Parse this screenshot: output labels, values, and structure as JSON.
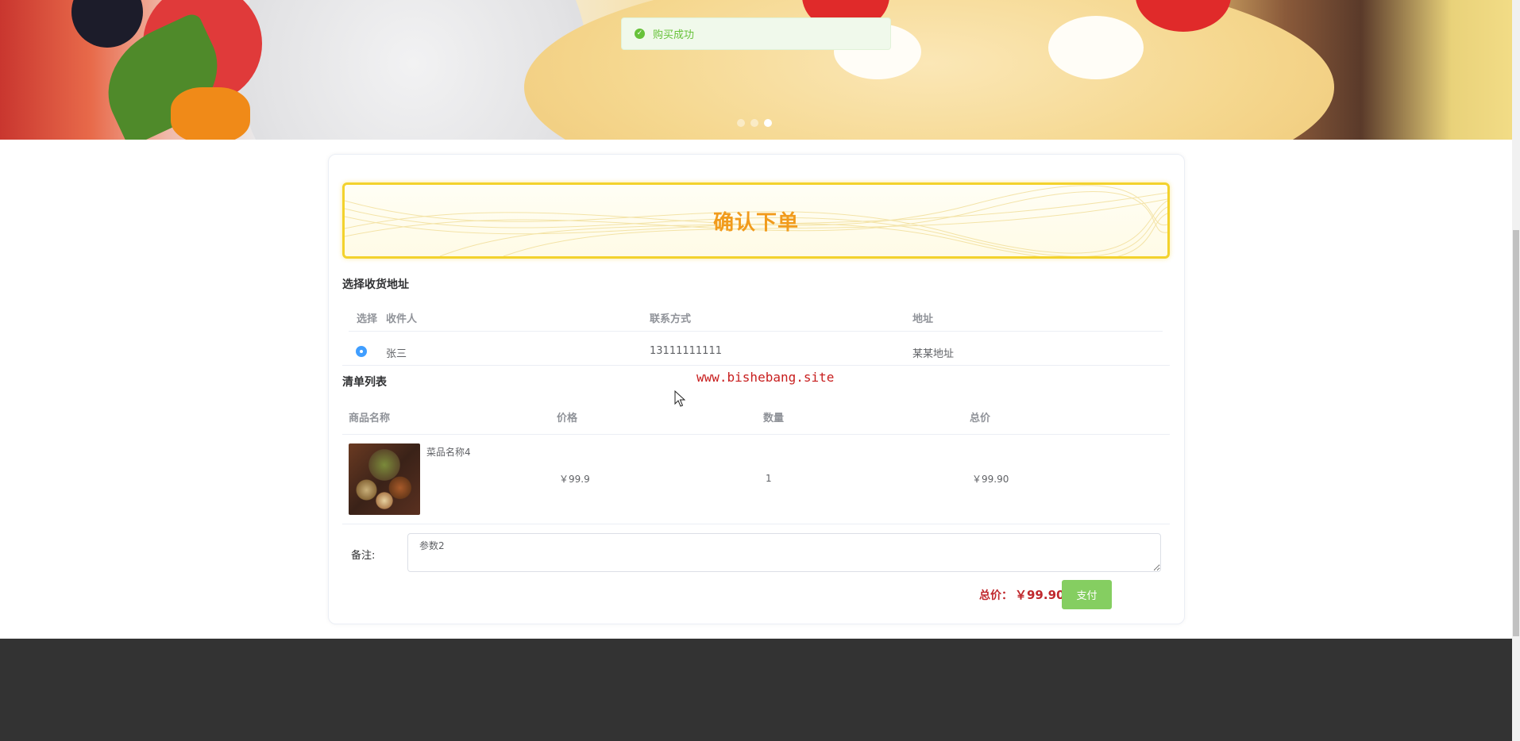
{
  "banner": {
    "dots": 3,
    "active_index": 2
  },
  "toast": {
    "message": "购买成功",
    "icon": "success-check-icon"
  },
  "page": {
    "title": "确认下单"
  },
  "address_section": {
    "label": "选择收货地址",
    "headers": [
      "选择",
      "收件人",
      "联系方式",
      "地址"
    ],
    "rows": [
      {
        "selected": true,
        "name": "张三",
        "phone": "13111111111",
        "address": "某某地址"
      }
    ]
  },
  "order_section": {
    "label": "清单列表",
    "headers": [
      "商品名称",
      "价格",
      "数量",
      "总价"
    ],
    "rows": [
      {
        "name": "菜品名称4",
        "price": "￥99.9",
        "quantity": "1",
        "total": "￥99.90"
      }
    ]
  },
  "remark": {
    "label": "备注:",
    "value": "参数2"
  },
  "summary": {
    "total_label": "总价：",
    "total_value": "￥99.90",
    "pay_label": "支付"
  },
  "watermark": "www.bishebang.site",
  "colors": {
    "accent": "#f3d22d",
    "title": "#f19b1c",
    "price": "#c0282d",
    "pay": "#85ce61",
    "success": "#67c23a",
    "footer": "#333333"
  }
}
